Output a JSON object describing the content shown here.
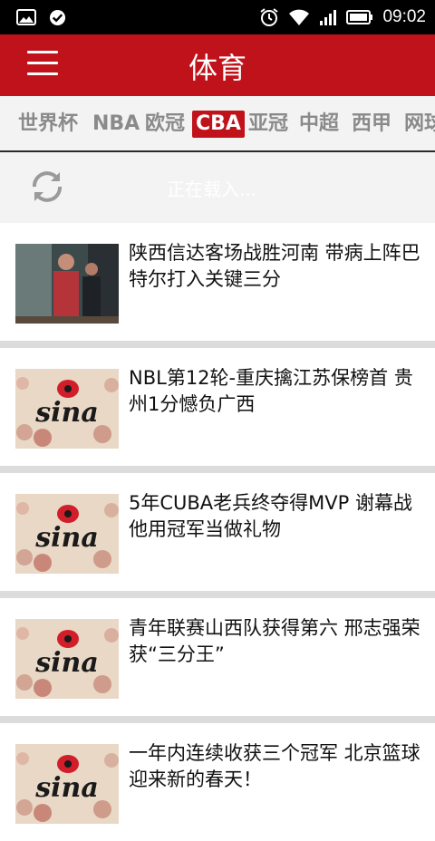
{
  "status_bar": {
    "time": "09:02"
  },
  "header": {
    "title": "体育"
  },
  "tabs": [
    {
      "label": "世界杯",
      "active": false
    },
    {
      "label": "NBA",
      "active": false
    },
    {
      "label": "欧冠",
      "active": false
    },
    {
      "label": "CBA",
      "active": true
    },
    {
      "label": "亚冠",
      "active": false
    },
    {
      "label": "中超",
      "active": false
    },
    {
      "label": "西甲",
      "active": false
    },
    {
      "label": "网球",
      "active": false
    }
  ],
  "loading": {
    "text": "正在载入..."
  },
  "news": [
    {
      "title": "陕西信达客场战胜河南 带病上阵巴特尔打入关键三分",
      "thumb": "photo"
    },
    {
      "title": "NBL第12轮-重庆擒江苏保榜首 贵州1分憾负广西",
      "thumb": "sina"
    },
    {
      "title": "5年CUBA老兵终夺得MVP 谢幕战他用冠军当做礼物",
      "thumb": "sina"
    },
    {
      "title": "青年联赛山西队获得第六 邢志强荣获“三分王”",
      "thumb": "sina"
    },
    {
      "title": "一年内连续收获三个冠军 北京篮球迎来新的春天！",
      "thumb": "sina"
    }
  ],
  "thumb_text": {
    "sina": "sina"
  },
  "colors": {
    "brand_red": "#c0121a",
    "tab_gray": "#8a8a8a",
    "bg_light": "#f3f3f3"
  }
}
